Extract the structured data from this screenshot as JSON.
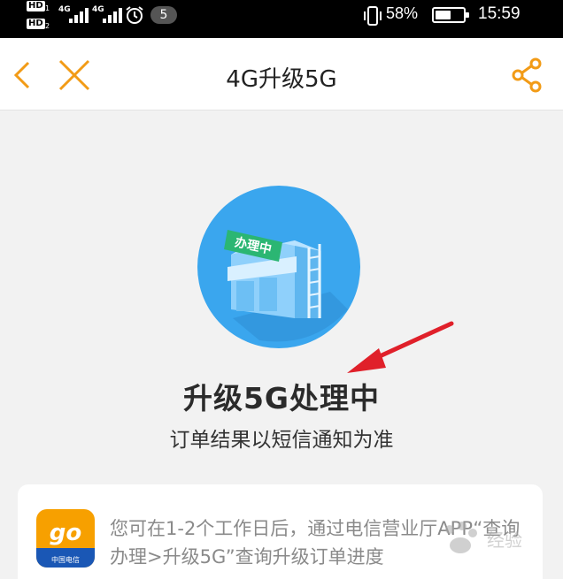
{
  "status_bar": {
    "hd1": "HD",
    "hd1_sub": "1",
    "hd2": "HD",
    "hd2_sub": "2",
    "net1": "4G",
    "net2": "4G",
    "notification_count": "5",
    "battery_percent": "58%",
    "battery_level": 0.58,
    "time": "15:59"
  },
  "nav": {
    "title": "4G升级5G",
    "back_icon": "chevron-left-icon",
    "close_icon": "close-icon",
    "share_icon": "share-icon",
    "accent_color": "#f29b16"
  },
  "hero": {
    "sign_text": "办理中"
  },
  "status": {
    "title": "升级5G处理中",
    "subtitle": "订单结果以短信通知为准"
  },
  "info_card": {
    "app_icon_label": "go",
    "app_icon_sub": "中国电信",
    "text": "您可在1-2个工作日后，通过电信营业厅APP“查询办理>升级5G”查询升级订单进度"
  },
  "watermark": {
    "text": "经验"
  },
  "colors": {
    "arrow": "#e0202a",
    "hero_circle": "#3aa6ee",
    "sign_green": "#2bb673"
  }
}
